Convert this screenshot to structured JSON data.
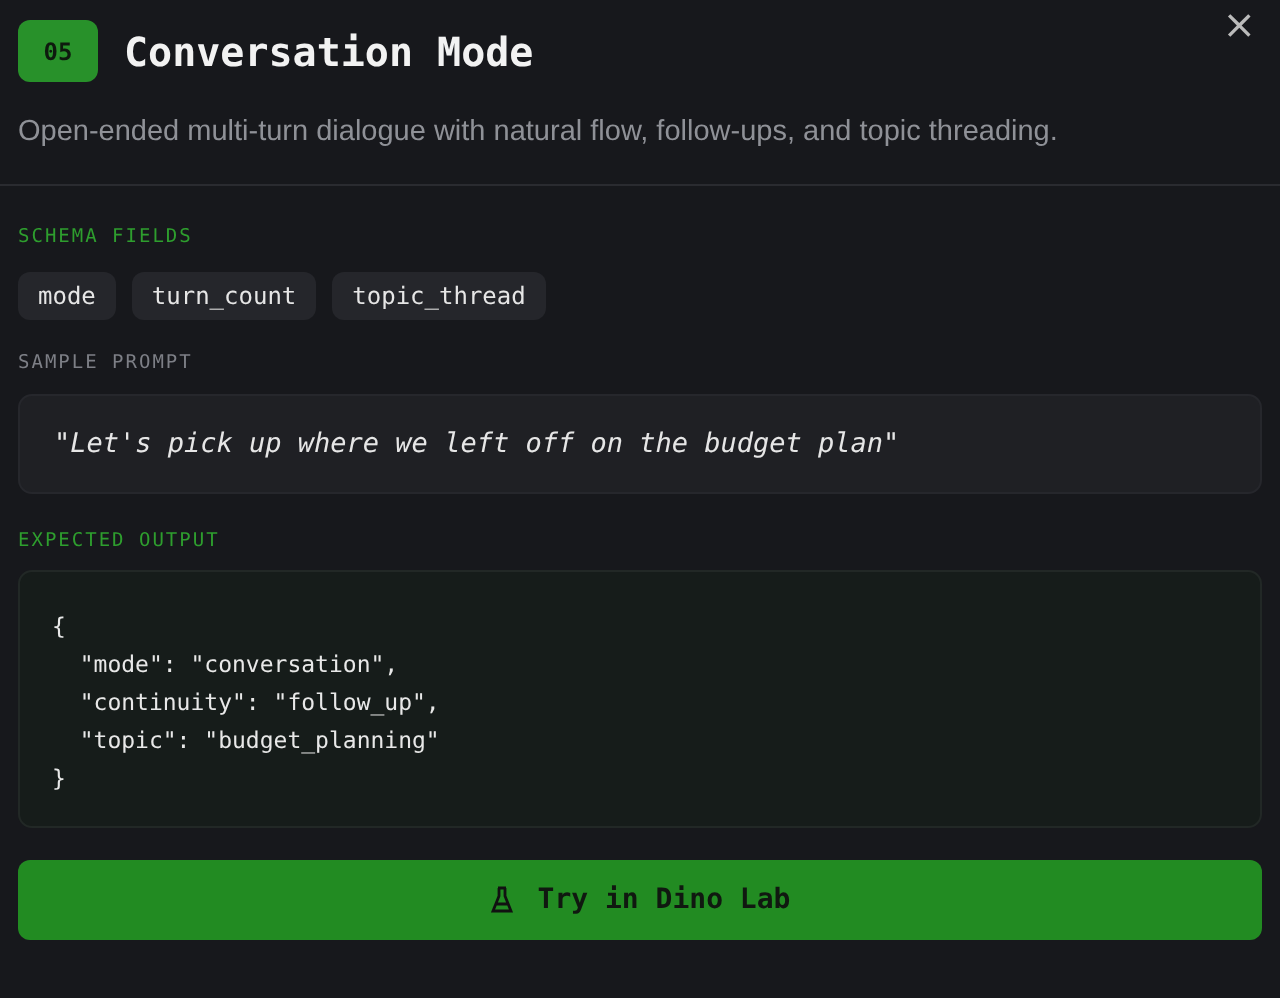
{
  "header": {
    "badge": "05",
    "title": "Conversation Mode",
    "description": "Open-ended multi-turn dialogue with natural flow, follow-ups, and topic threading.",
    "close": "×"
  },
  "schema": {
    "label": "SCHEMA FIELDS",
    "color": "#2e9e2e",
    "fields": [
      "mode",
      "turn_count",
      "topic_thread"
    ]
  },
  "prompt": {
    "label": "SAMPLE PROMPT",
    "color": "#7d7f86",
    "text": "\"Let's pick up where we left off on the budget plan\""
  },
  "output": {
    "label": "EXPECTED OUTPUT",
    "color": "#2e9e2e",
    "lines": [
      "{",
      "  \"mode\": \"conversation\",",
      "  \"continuity\": \"follow_up\",",
      "  \"topic\": \"budget_planning\"",
      "}"
    ]
  },
  "action": {
    "label": "Try in Dino Lab"
  }
}
